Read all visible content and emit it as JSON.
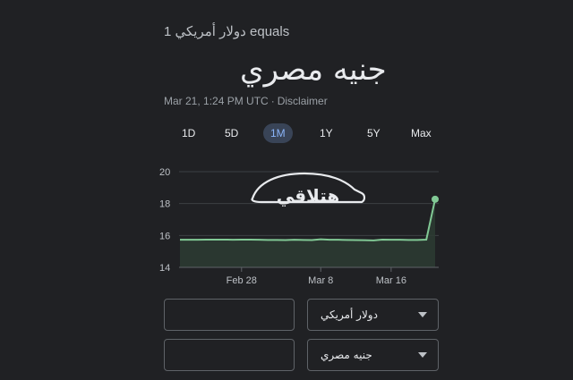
{
  "header": {
    "subtitle": "1 دولار أمريكي equals",
    "value_text": "جنيه مصري",
    "timestamp": "Mar 21, 1:24 PM UTC",
    "separator": "·",
    "disclaimer": "Disclaimer"
  },
  "tabs": [
    {
      "label": "1D",
      "active": false
    },
    {
      "label": "5D",
      "active": false
    },
    {
      "label": "1M",
      "active": true
    },
    {
      "label": "1Y",
      "active": false
    },
    {
      "label": "5Y",
      "active": false
    },
    {
      "label": "Max",
      "active": false
    }
  ],
  "watermark": "هتلاقي",
  "chart_data": {
    "type": "line",
    "x": [
      "Feb 21",
      "Feb 22",
      "Feb 23",
      "Feb 24",
      "Feb 25",
      "Feb 26",
      "Feb 27",
      "Feb 28",
      "Feb 29",
      "Mar 1",
      "Mar 2",
      "Mar 3",
      "Mar 4",
      "Mar 5",
      "Mar 6",
      "Mar 7",
      "Mar 8",
      "Mar 9",
      "Mar 10",
      "Mar 11",
      "Mar 12",
      "Mar 13",
      "Mar 14",
      "Mar 15",
      "Mar 16",
      "Mar 17",
      "Mar 18",
      "Mar 19",
      "Mar 20",
      "Mar 21"
    ],
    "values": [
      15.73,
      15.73,
      15.73,
      15.74,
      15.74,
      15.74,
      15.73,
      15.74,
      15.74,
      15.73,
      15.72,
      15.72,
      15.71,
      15.73,
      15.72,
      15.71,
      15.76,
      15.73,
      15.73,
      15.72,
      15.71,
      15.7,
      15.69,
      15.74,
      15.73,
      15.73,
      15.72,
      15.72,
      15.74,
      18.27
    ],
    "yticks": [
      "14",
      "16",
      "18",
      "20"
    ],
    "ylim": [
      14,
      20
    ],
    "xticks": [
      "Feb 28",
      "Mar 8",
      "Mar 16"
    ],
    "line_color": "#81c995",
    "grid": true
  },
  "converter": {
    "from_value": "",
    "to_value": "",
    "from_currency": "دولار أمريكي",
    "to_currency": "جنيه مصري"
  }
}
